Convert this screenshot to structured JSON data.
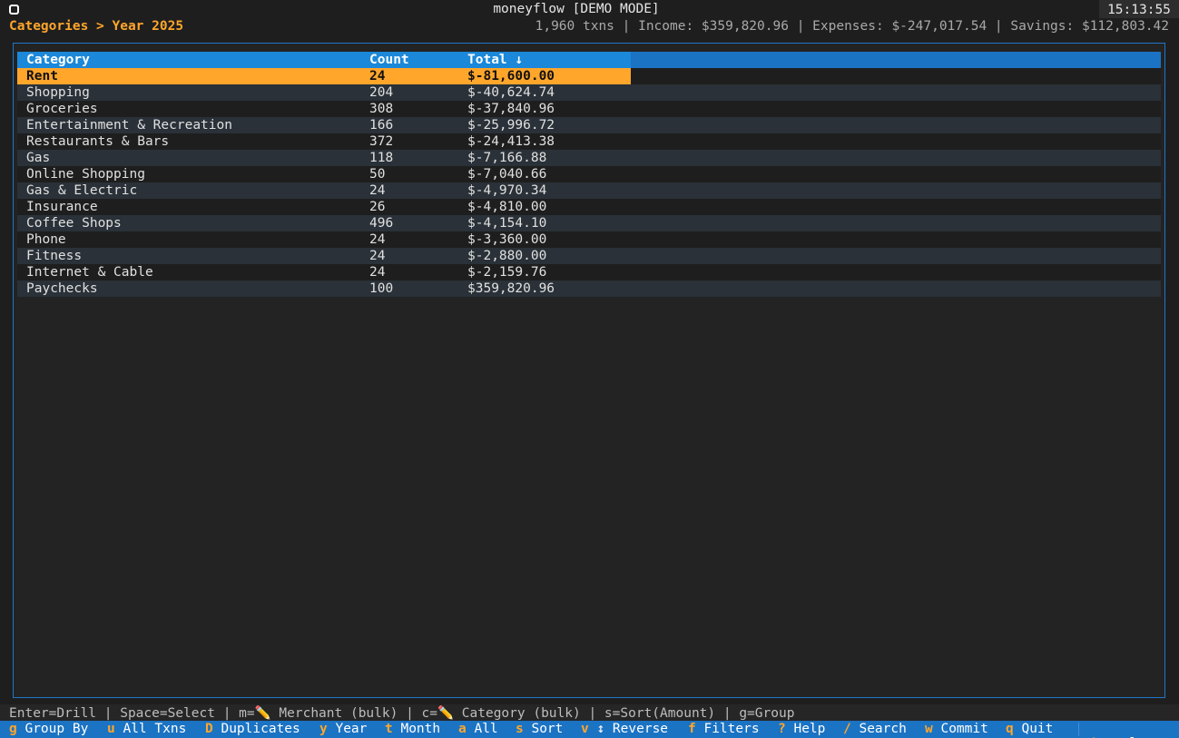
{
  "app": {
    "title": "moneyflow [DEMO MODE]",
    "clock": "15:13:55"
  },
  "breadcrumb": "Categories > Year 2025",
  "summary": "1,960 txns | Income: $359,820.96 | Expenses: $-247,017.54 | Savings: $112,803.42",
  "table": {
    "headers": {
      "category": "Category",
      "count": "Count",
      "total": "Total ↓"
    },
    "rows": [
      {
        "category": "Rent",
        "count": "24",
        "total": "$-81,600.00"
      },
      {
        "category": "Shopping",
        "count": "204",
        "total": "$-40,624.74"
      },
      {
        "category": "Groceries",
        "count": "308",
        "total": "$-37,840.96"
      },
      {
        "category": "Entertainment & Recreation",
        "count": "166",
        "total": "$-25,996.72"
      },
      {
        "category": "Restaurants & Bars",
        "count": "372",
        "total": "$-24,413.38"
      },
      {
        "category": "Gas",
        "count": "118",
        "total": "$-7,166.88"
      },
      {
        "category": "Online Shopping",
        "count": "50",
        "total": "$-7,040.66"
      },
      {
        "category": "Gas & Electric",
        "count": "24",
        "total": "$-4,970.34"
      },
      {
        "category": "Insurance",
        "count": "26",
        "total": "$-4,810.00"
      },
      {
        "category": "Coffee Shops",
        "count": "496",
        "total": "$-4,154.10"
      },
      {
        "category": "Phone",
        "count": "24",
        "total": "$-3,360.00"
      },
      {
        "category": "Fitness",
        "count": "24",
        "total": "$-2,880.00"
      },
      {
        "category": "Internet & Cable",
        "count": "24",
        "total": "$-2,159.76"
      },
      {
        "category": "Paychecks",
        "count": "100",
        "total": "$359,820.96"
      }
    ]
  },
  "help_line": "Enter=Drill | Space=Select | m=✏️ Merchant (bulk) | c=✏️ Category (bulk) | s=Sort(Amount) | g=Group",
  "keybar": [
    {
      "key": "g",
      "label": "Group By"
    },
    {
      "key": "u",
      "label": "All Txns"
    },
    {
      "key": "D",
      "label": "Duplicates"
    },
    {
      "key": "y",
      "label": "Year"
    },
    {
      "key": "t",
      "label": "Month"
    },
    {
      "key": "a",
      "label": "All"
    },
    {
      "key": "s",
      "label": "Sort"
    },
    {
      "key": "v",
      "label": "↕ Reverse"
    },
    {
      "key": "f",
      "label": "Filters"
    },
    {
      "key": "?",
      "label": "Help"
    },
    {
      "key": "/",
      "label": "Search"
    },
    {
      "key": "w",
      "label": "Commit"
    },
    {
      "key": "q",
      "label": "Quit"
    }
  ],
  "palette": {
    "key": "^p",
    "label": "palette"
  },
  "colors": {
    "accent": "#ffa62b",
    "header_blue": "#1b73c3",
    "border_blue": "#1e77c7"
  }
}
